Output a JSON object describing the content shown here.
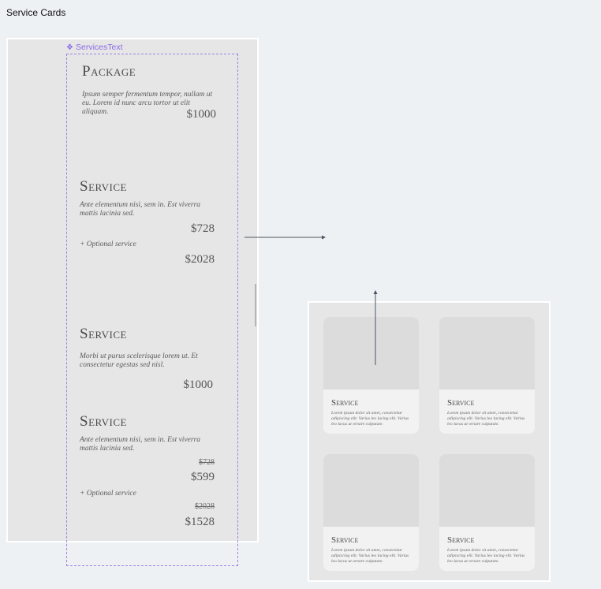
{
  "canvas": {
    "title": "Service Cards"
  },
  "component": {
    "label": "ServicesText"
  },
  "services_text": {
    "package": {
      "title": "Package",
      "description": "Ipsum semper fermentum tempor, nullam ut eu. Lorem id nunc arcu tortor ut elit aliquam.",
      "price": "$1000"
    },
    "service_1": {
      "title": "Service",
      "description": "Ante elementum nisi, sem in. Est viverra mattis lacinia sed.",
      "price": "$728",
      "optional_label": "+ Optional service",
      "optional_price": "$2028"
    },
    "service_2": {
      "title": "Service",
      "description": "Morbi ut purus scelerisque lorem ut. Et consectetur egestas sed nisl.",
      "price": "$1000"
    },
    "service_3": {
      "title": "Service",
      "description": "Ante elementum nisi, sem in. Est viverra mattis lacinia sed.",
      "old_price": "$728",
      "price": "$599",
      "optional_label": "+ Optional service",
      "optional_old_price": "$2028",
      "optional_price": "$1528"
    }
  },
  "cards": [
    {
      "title": "Service",
      "text": "Lorem ipsum dolor sit amet, consectetur adipiscing elit. Varius leo lacing elit. Varius leo lacus ut ornare culputate."
    },
    {
      "title": "Service",
      "text": "Lorem ipsum dolor sit amet, consectetur adipiscing elit. Varius leo lacing elit. Varius leo lacus ut ornare culputate."
    },
    {
      "title": "Service",
      "text": "Lorem ipsum dolor sit amet, consectetur adipiscing elit. Varius leo lacing elit. Varius leo lacus ut ornare culputate."
    },
    {
      "title": "Service",
      "text": "Lorem ipsum dolor sit amet, consectetur adipiscing elit. Varius leo lacing elit. Varius leo lacus ut ornare culputate."
    }
  ],
  "colors": {
    "canvas_bg": "#eef1f4",
    "frame_bg": "#e6e6e6",
    "component_accent": "#8b6be6",
    "card_bg": "#f2f2f2",
    "card_image_bg": "#dcdcdc",
    "connector": "#4a5562"
  }
}
